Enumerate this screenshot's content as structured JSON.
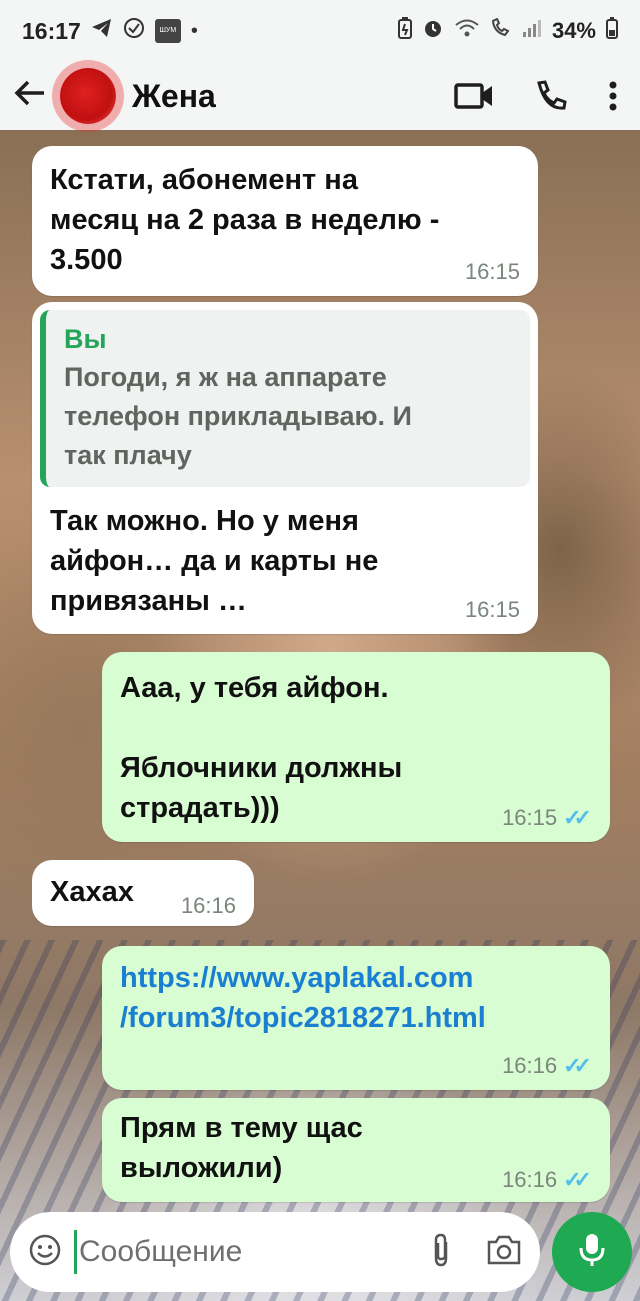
{
  "status_bar": {
    "time": "16:17",
    "left_icons": [
      "telegram-icon",
      "check-circle-icon",
      "app-badge-icon",
      "dot-icon"
    ],
    "app_badge_text": "ШУМ",
    "right_icons": [
      "battery-saver-icon",
      "alarm-icon",
      "wifi-icon",
      "call-icon",
      "signal-icon"
    ],
    "battery": "34%"
  },
  "header": {
    "contact_name": "Жена",
    "actions": [
      "video-call-icon",
      "phone-call-icon",
      "more-options-icon"
    ]
  },
  "messages": [
    {
      "direction": "in",
      "text": "Кстати, абонемент на\nмесяц на 2 раза в неделю -\n3.500",
      "time": "16:15"
    },
    {
      "direction": "in",
      "quote_author": "Вы",
      "quote_text": "Погоди, я ж на аппарате\nтелефон прикладываю. И\nтак плачу",
      "text": "Так можно. Но у меня\nайфон… да и карты не\nпривязаны …",
      "time": "16:15"
    },
    {
      "direction": "out",
      "text": "Ааа, у тебя айфон.\n\nЯблочники должны\nстрадать)))",
      "time": "16:15",
      "read": true
    },
    {
      "direction": "in",
      "text": "Хахах",
      "time": "16:16"
    },
    {
      "direction": "out",
      "text": "https://www.yaplakal.com\n/forum3/topic2818271.html",
      "time": "16:16",
      "read": true,
      "is_link": true
    },
    {
      "direction": "out",
      "text": "Прям в тему щас\nвыложили)",
      "time": "16:16",
      "read": true
    }
  ],
  "composer": {
    "placeholder": "Сообщение",
    "icons": [
      "emoji-icon",
      "attach-icon",
      "camera-icon"
    ],
    "send_icon": "microphone-icon"
  },
  "colors": {
    "accent_green": "#1ea952",
    "outgoing_bubble": "#d9fdd3",
    "incoming_bubble": "#ffffff",
    "read_ticks": "#53bdeb",
    "link": "#1a7fd1"
  }
}
